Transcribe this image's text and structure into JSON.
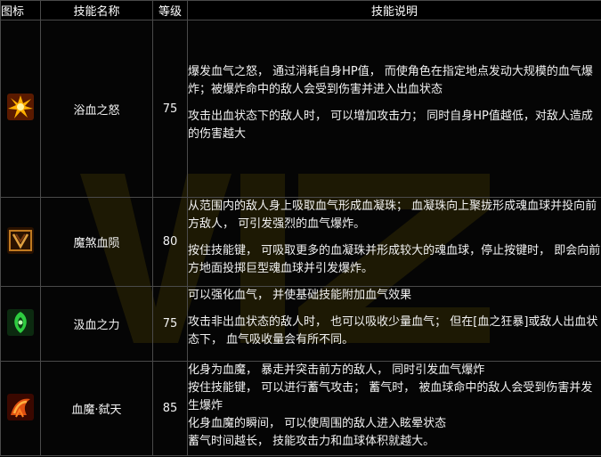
{
  "headers": {
    "icon": "图标",
    "name": "技能名称",
    "level": "等级",
    "desc": "技能说明"
  },
  "skills": [
    {
      "icon": "explosion-burst-icon",
      "name": "浴血之怒",
      "level": "75",
      "desc": [
        "爆发血气之怒， 通过消耗自身HP值， 而使角色在指定地点发动大规模的血气爆炸；被爆炸命中的敌人会受到伤害并进入出血状态",
        "攻击出血状态下的敌人时， 可以增加攻击力； 同时自身HP值越低，对敌人造成的伤害越大"
      ]
    },
    {
      "icon": "blood-crystal-icon",
      "name": "魔煞血陨",
      "level": "80",
      "desc": [
        "从范围内的敌人身上吸取血气形成血凝珠； 血凝珠向上聚拢形成魂血球并投向前方敌人， 可引发强烈的血气爆炸。",
        "按住技能键， 可吸取更多的血凝珠并形成较大的魂血球，停止按键时， 即会向前方地面投掷巨型魂血球并引发爆炸。"
      ]
    },
    {
      "icon": "green-aura-icon",
      "name": "汲血之力",
      "level": "75",
      "desc": [
        "可以强化血气， 并使基础技能附加血气效果",
        "攻击非出血状态的敌人时， 也可以吸收少量血气； 但在[血之狂暴]或敌人出血状态下， 血气吸收量会有所不同。"
      ]
    },
    {
      "icon": "blood-demon-icon",
      "name": "血魔·弑天",
      "level": "85",
      "desc": [
        "化身为血魔， 暴走并突击前方的敌人， 同时引发血气爆炸",
        "按住技能键， 可以进行蓄气攻击； 蓄气时， 被血球命中的敌人会受到伤害并发生爆炸",
        "化身血魔的瞬间， 可以使周围的敌人进入眩晕状态",
        "蓄气时间越长， 技能攻击力和血球体积就越大。"
      ]
    }
  ]
}
